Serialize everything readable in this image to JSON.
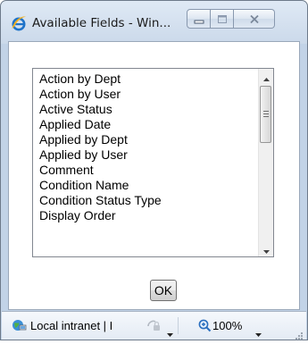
{
  "window": {
    "title": "Available Fields - Win...",
    "icon": "ie-logo-icon",
    "controls": [
      "minimize-icon",
      "maximize-icon",
      "close-icon"
    ]
  },
  "list": {
    "items": [
      "Action by Dept",
      "Action by User",
      "Active Status",
      "Applied Date",
      "Applied by Dept",
      "Applied by User",
      "Comment",
      "Condition Name",
      "Condition Status Type",
      "Display Order"
    ]
  },
  "buttons": {
    "ok_label": "OK"
  },
  "statusbar": {
    "zone_text": "Local intranet | I",
    "zoom_text": "100%",
    "zone_icon": "local-intranet-icon",
    "protected_mode_icon": "protected-mode-icon",
    "zoom_icon": "zoom-magnifier-icon"
  },
  "colors": {
    "title_bar": "#cbd9ea",
    "close_hover": "#c0c8d4",
    "list_border": "#828790"
  }
}
